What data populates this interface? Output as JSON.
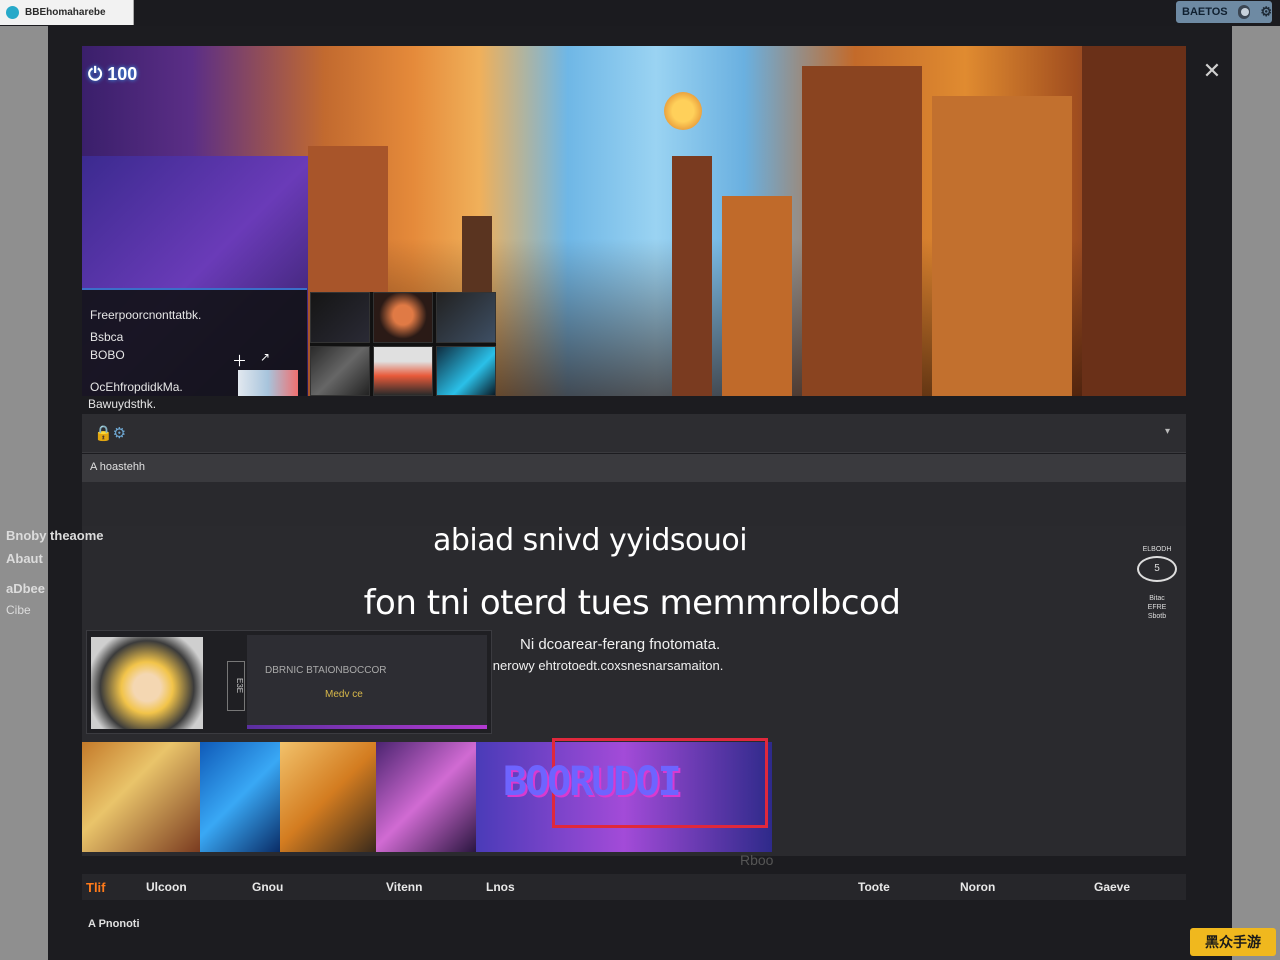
{
  "app_tab": {
    "title": "BBEhomaharebe"
  },
  "top_right": {
    "pill_label": "BAETOS"
  },
  "hero": {
    "logo_text": "100",
    "info_lines": [
      "Freerpoorcnonttatbk.",
      "Bsbca",
      "BOBO",
      "OcEhfropdidkMa.",
      "Bawuydsthk."
    ]
  },
  "toolbar": {
    "icons": "🔒⚙"
  },
  "breadcrumb": "A hoastehh",
  "side_labels": [
    "Bnoby theaome",
    "Abaut",
    "aDbee",
    "Cibe"
  ],
  "headline_1": "abiad snivd yyidsouoi",
  "headline_2": "fon tni oterd  tues memmrolbcod",
  "subtext_1": "Ni dcoarear-ferang fnotomata.",
  "subtext_2": "Ges launerowy ehtrotoedt.coxsnesnarsamaiton.",
  "right_widgets": {
    "label": "ELBODH",
    "badge": "5",
    "list": [
      "Bitac",
      "EFRE",
      "Sbotb"
    ]
  },
  "card": {
    "vertical_text": "E3E",
    "panel_row_1": "DBRNIC   BTAIONBOCCOR",
    "panel_row_2": "Medv ce"
  },
  "promo_text": "BOORUDOI",
  "strip_caption": "Rboo",
  "nav": {
    "brand": "Tlif",
    "items": [
      "Ulcoon",
      "Gnou",
      "Vitenn",
      "Lnos",
      "Toote",
      "Noron",
      "Gaeve"
    ]
  },
  "footer_text": "A Pnonoti",
  "watermark": "黑众手游"
}
